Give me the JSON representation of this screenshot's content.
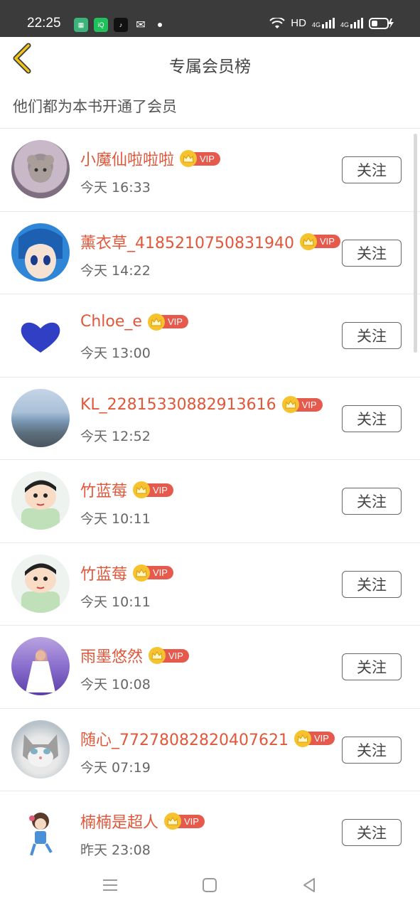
{
  "status_bar": {
    "time": "22:25",
    "network": "HD",
    "signal1": "4G",
    "signal2": "4G"
  },
  "header": {
    "title": "专属会员榜"
  },
  "subtitle": "他们都为本书开通了会员",
  "vip_label": "VIP",
  "follow_label": "关注",
  "members": [
    {
      "name": "小魔仙啦啦啦",
      "time": "今天 16:33",
      "avatar": "bear-avatar"
    },
    {
      "name": "薰衣草_4185210750831940",
      "time": "今天 14:22",
      "avatar": "anime-avatar"
    },
    {
      "name": "Chloe_e",
      "time": "今天 13:00",
      "avatar": "heart-avatar"
    },
    {
      "name": "KL_22815330882913616",
      "time": "今天 12:52",
      "avatar": "sea-avatar"
    },
    {
      "name": "竹蓝莓",
      "time": "今天 10:11",
      "avatar": "cartoon-avatar"
    },
    {
      "name": "竹蓝莓",
      "time": "今天 10:11",
      "avatar": "cartoon-avatar"
    },
    {
      "name": "雨墨悠然",
      "time": "今天 10:08",
      "avatar": "girl-avatar"
    },
    {
      "name": "随心_77278082820407621",
      "time": "今天 07:19",
      "avatar": "cat-avatar"
    },
    {
      "name": "楠楠是超人",
      "time": "昨天 23:08",
      "avatar": "kid-avatar"
    }
  ],
  "colors": {
    "name": "#e0573a",
    "vip_bg": "#e55a4c",
    "crown": "#f6c32e",
    "back_arrow": "#f0c419",
    "status_bar": "#3b3b3b"
  }
}
